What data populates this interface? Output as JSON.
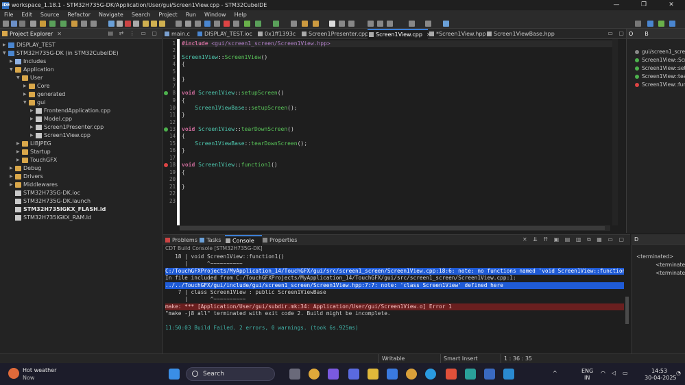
{
  "window": {
    "title": "workspace_1.18.1 - STM32H735G-DK/Application/User/gui/Screen1View.cpp - STM32CubeIDE",
    "app_icon": "IDE",
    "controls": [
      "—",
      "❐",
      "✕"
    ]
  },
  "menu": [
    "File",
    "Edit",
    "Source",
    "Refactor",
    "Navigate",
    "Search",
    "Project",
    "Run",
    "Window",
    "Help"
  ],
  "explorer": {
    "title": "Project Explorer",
    "close": "✕",
    "items": [
      {
        "label": "DISPLAY_TEST",
        "level": 0,
        "expanded": false,
        "kind": "proj"
      },
      {
        "label": "STM32H735G-DK (in STM32CubeIDE)",
        "level": 0,
        "expanded": true,
        "kind": "proj"
      },
      {
        "label": "Includes",
        "level": 1,
        "expanded": false,
        "kind": "pkg"
      },
      {
        "label": "Application",
        "level": 1,
        "expanded": true,
        "kind": "folder"
      },
      {
        "label": "User",
        "level": 2,
        "expanded": true,
        "kind": "folder"
      },
      {
        "label": "Core",
        "level": 3,
        "expanded": false,
        "kind": "folder"
      },
      {
        "label": "generated",
        "level": 3,
        "expanded": false,
        "kind": "folder"
      },
      {
        "label": "gui",
        "level": 3,
        "expanded": true,
        "kind": "folder"
      },
      {
        "label": "FrontendApplication.cpp",
        "level": 4,
        "expanded": false,
        "kind": "file"
      },
      {
        "label": "Model.cpp",
        "level": 4,
        "expanded": false,
        "kind": "file"
      },
      {
        "label": "Screen1Presenter.cpp",
        "level": 4,
        "expanded": false,
        "kind": "file"
      },
      {
        "label": "Screen1View.cpp",
        "level": 4,
        "expanded": false,
        "kind": "file"
      },
      {
        "label": "LIBJPEG",
        "level": 2,
        "expanded": false,
        "kind": "folder"
      },
      {
        "label": "Startup",
        "level": 2,
        "expanded": false,
        "kind": "folder"
      },
      {
        "label": "TouchGFX",
        "level": 2,
        "expanded": false,
        "kind": "folder"
      },
      {
        "label": "Debug",
        "level": 1,
        "expanded": false,
        "kind": "folder"
      },
      {
        "label": "Drivers",
        "level": 1,
        "expanded": false,
        "kind": "folder"
      },
      {
        "label": "Middlewares",
        "level": 1,
        "expanded": false,
        "kind": "folder"
      },
      {
        "label": "STM32H735G-DK.ioc",
        "level": 1,
        "expanded": null,
        "kind": "file"
      },
      {
        "label": "STM32H735G-DK.launch",
        "level": 1,
        "expanded": null,
        "kind": "file"
      },
      {
        "label": "STM32H735IGKX_FLASH.ld",
        "level": 1,
        "expanded": null,
        "kind": "file",
        "bold": true
      },
      {
        "label": "STM32H735IGKX_RAM.ld",
        "level": 1,
        "expanded": null,
        "kind": "file"
      }
    ]
  },
  "editor": {
    "tabs": [
      {
        "label": "main.c",
        "active": false
      },
      {
        "label": "DISPLAY_TEST.ioc",
        "active": false
      },
      {
        "label": "0x1ff1393c",
        "active": false
      },
      {
        "label": "Screen1Presenter.cpp",
        "active": false
      },
      {
        "label": "Screen1View.cpp",
        "active": true
      },
      {
        "label": "*Screen1View.hpp",
        "active": false
      },
      {
        "label": "Screen1ViewBase.hpp",
        "active": false
      }
    ],
    "close_glyph": "✕",
    "line_numbers": [
      "1",
      "2",
      "3",
      "4",
      "5",
      "6",
      "7",
      "8",
      "9",
      "10",
      "11",
      "12",
      "13",
      "14",
      "15",
      "16",
      "17",
      "18",
      "19",
      "20",
      "21",
      "22",
      "23"
    ],
    "code": {
      "l1_kw": "#include",
      "l1_str": " <gui/screen1_screen/Screen1View.hpp>",
      "l3_cls": "Screen1View",
      "l3_sep": "::",
      "l3_fn": "Screen1View",
      "l3_paren": "()",
      "brace_open": "{",
      "brace_close": "}",
      "l8_kw": "void ",
      "l8_cls": "Screen1View",
      "l8_sep": "::",
      "l8_fn": "setupScreen",
      "l8_paren": "()",
      "l10_cls": "    Screen1ViewBase",
      "l10_sep": "::",
      "l10_fn": "setupScreen",
      "l10_tail": "();",
      "l13_kw": "void ",
      "l13_cls": "Screen1View",
      "l13_sep": "::",
      "l13_fn": "tearDownScreen",
      "l13_paren": "()",
      "l15_cls": "    Screen1ViewBase",
      "l15_sep": "::",
      "l15_fn": "tearDownScreen",
      "l15_tail": "();",
      "l18_kw": "void ",
      "l18_cls": "Screen1View",
      "l18_sep": "::",
      "l18_fn": "function1",
      "l18_paren": "()"
    }
  },
  "outline": {
    "tabs": [
      "O",
      "B"
    ],
    "items": [
      "gui/screen1_scree",
      "Screen1View::Scr",
      "Screen1View::setu",
      "Screen1View::tear",
      "Screen1View::func"
    ]
  },
  "console": {
    "tabs": [
      {
        "label": "Problems",
        "active": false
      },
      {
        "label": "Tasks",
        "active": false
      },
      {
        "label": "Console",
        "active": true
      },
      {
        "label": "Properties",
        "active": false
      }
    ],
    "subtitle": "CDT Build Console [STM32H735G-DK]",
    "lines": [
      {
        "text": "   18 | void Screen1View::function1()",
        "style": "normal"
      },
      {
        "text": "      |      ^~~~~~~~~~~",
        "style": "normal"
      },
      {
        "text": "C:/TouchGFXProjects/MyApplication_14/TouchGFX/gui/src/screen1_screen/Screen1View.cpp:18:6: note: no functions named 'void Screen1View::function",
        "style": "blue"
      },
      {
        "text": "In file included from C:/TouchGFXProjects/MyApplication_14/TouchGFX/gui/src/screen1_screen/Screen1View.cpp:1:",
        "style": "normal"
      },
      {
        "text": "../../TouchGFX/gui/include/gui/screen1_screen/Screen1View.hpp:7:7: note: 'class Screen1View' defined here",
        "style": "blue"
      },
      {
        "text": "    7 | class Screen1View : public Screen1ViewBase",
        "style": "normal"
      },
      {
        "text": "      |       ^~~~~~~~~~~",
        "style": "normal"
      },
      {
        "text": "make: *** [Application/User/gui/subdir.mk:34: Application/User/gui/Screen1View.o] Error 1",
        "style": "red"
      },
      {
        "text": "\"make -j8 all\" terminated with exit code 2. Build might be incomplete.",
        "style": "normal"
      },
      {
        "text": "",
        "style": "normal"
      },
      {
        "text": "11:50:03 Build Failed. 2 errors, 0 warnings. (took 6s.925ms)",
        "style": "green"
      }
    ]
  },
  "debug_view": {
    "title": "D",
    "items": [
      "<terminated>",
      "<terminated>",
      "<terminated>"
    ]
  },
  "statusbar": {
    "writable": "Writable",
    "insert_mode": "Smart Insert",
    "position": "1 : 36 : 35"
  },
  "taskbar": {
    "weather_title": "Hot weather",
    "weather_sub": "Now",
    "search_placeholder": "Search",
    "lang_top": "ENG",
    "lang_bottom": "IN",
    "time": "14:53",
    "date": "30-04-2025"
  }
}
